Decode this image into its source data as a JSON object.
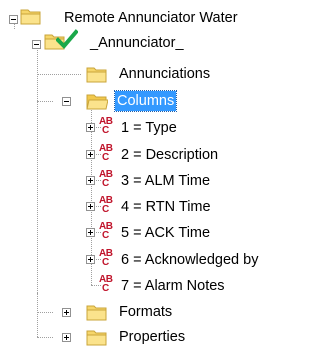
{
  "tree": {
    "root": {
      "label": "Remote Annunciator Water"
    },
    "item": {
      "label": "_Annunciator_"
    },
    "annunciations": {
      "label": "Annunciations"
    },
    "columns": {
      "label": "Columns",
      "children": [
        {
          "label": "1 = Type"
        },
        {
          "label": "2 = Description"
        },
        {
          "label": "3 = ALM Time"
        },
        {
          "label": "4 = RTN Time"
        },
        {
          "label": "5 = ACK Time"
        },
        {
          "label": "6 = Acknowledged by"
        },
        {
          "label": "7 = Alarm Notes"
        }
      ]
    },
    "formats": {
      "label": "Formats"
    },
    "properties": {
      "label": "Properties"
    }
  },
  "colors": {
    "selection": "#3399ff",
    "folder": "#f2d35b",
    "check": "#1aa84a",
    "field_icon": "#c0142b"
  }
}
